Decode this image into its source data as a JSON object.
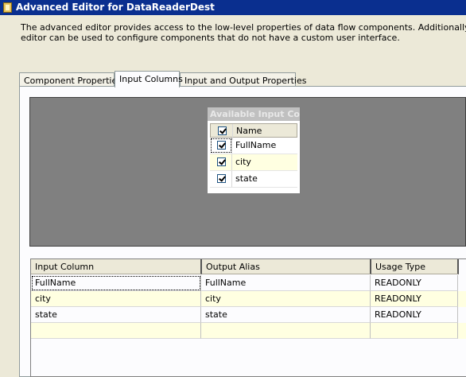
{
  "window": {
    "title": "Advanced Editor for DataReaderDest"
  },
  "description": {
    "line1": "The advanced editor provides access to the low-level properties of data flow components. Additionally, the advanced",
    "line2": "editor can be used to configure components that do not have a custom user interface."
  },
  "tabs": [
    {
      "label": "Component Properties",
      "active": false
    },
    {
      "label": "Input Columns",
      "active": true
    },
    {
      "label": "Input and Output Properties",
      "active": false
    }
  ],
  "available_columns": {
    "title": "Available Input Co...",
    "header": "Name",
    "header_checked": true,
    "items": [
      {
        "name": "FullName",
        "checked": true
      },
      {
        "name": "city",
        "checked": true
      },
      {
        "name": "state",
        "checked": true
      }
    ]
  },
  "mapping_grid": {
    "headers": [
      "Input Column",
      "Output Alias",
      "Usage Type"
    ],
    "rows": [
      [
        "FullName",
        "FullName",
        "READONLY"
      ],
      [
        "city",
        "city",
        "READONLY"
      ],
      [
        "state",
        "state",
        "READONLY"
      ],
      [
        "",
        "",
        ""
      ]
    ]
  }
}
